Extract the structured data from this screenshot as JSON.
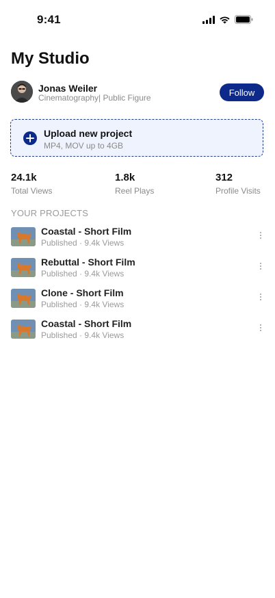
{
  "status_bar": {
    "time": "9:41"
  },
  "header": {
    "title": "My Studio"
  },
  "profile": {
    "name": "Jonas Weiler",
    "subtitle": "Cinematography| Public Figure",
    "follow_label": "Follow"
  },
  "upload": {
    "title": "Upload new project",
    "subtitle": "MP4, MOV up to 4GB"
  },
  "stats": [
    {
      "value": "24.1k",
      "label": "Total Views"
    },
    {
      "value": "1.8k",
      "label": "Reel Plays"
    },
    {
      "value": "312",
      "label": "Profile Visits"
    }
  ],
  "projects_section": {
    "title": "YOUR PROJECTS",
    "items": [
      {
        "title": "Coastal - Short Film",
        "status": "Published",
        "views": "9.4k Views"
      },
      {
        "title": "Rebuttal - Short Film",
        "status": "Published",
        "views": "9.4k Views"
      },
      {
        "title": "Clone - Short Film",
        "status": "Published",
        "views": "9.4k Views"
      },
      {
        "title": "Coastal - Short Film",
        "status": "Published",
        "views": "9.4k Views"
      }
    ]
  },
  "colors": {
    "accent": "#0d2a8a",
    "upload_bg": "#eef3fd",
    "muted_text": "#8a8a8a"
  },
  "icons": [
    "signal-icon",
    "wifi-icon",
    "battery-icon",
    "plus-icon",
    "more-vertical-icon"
  ]
}
